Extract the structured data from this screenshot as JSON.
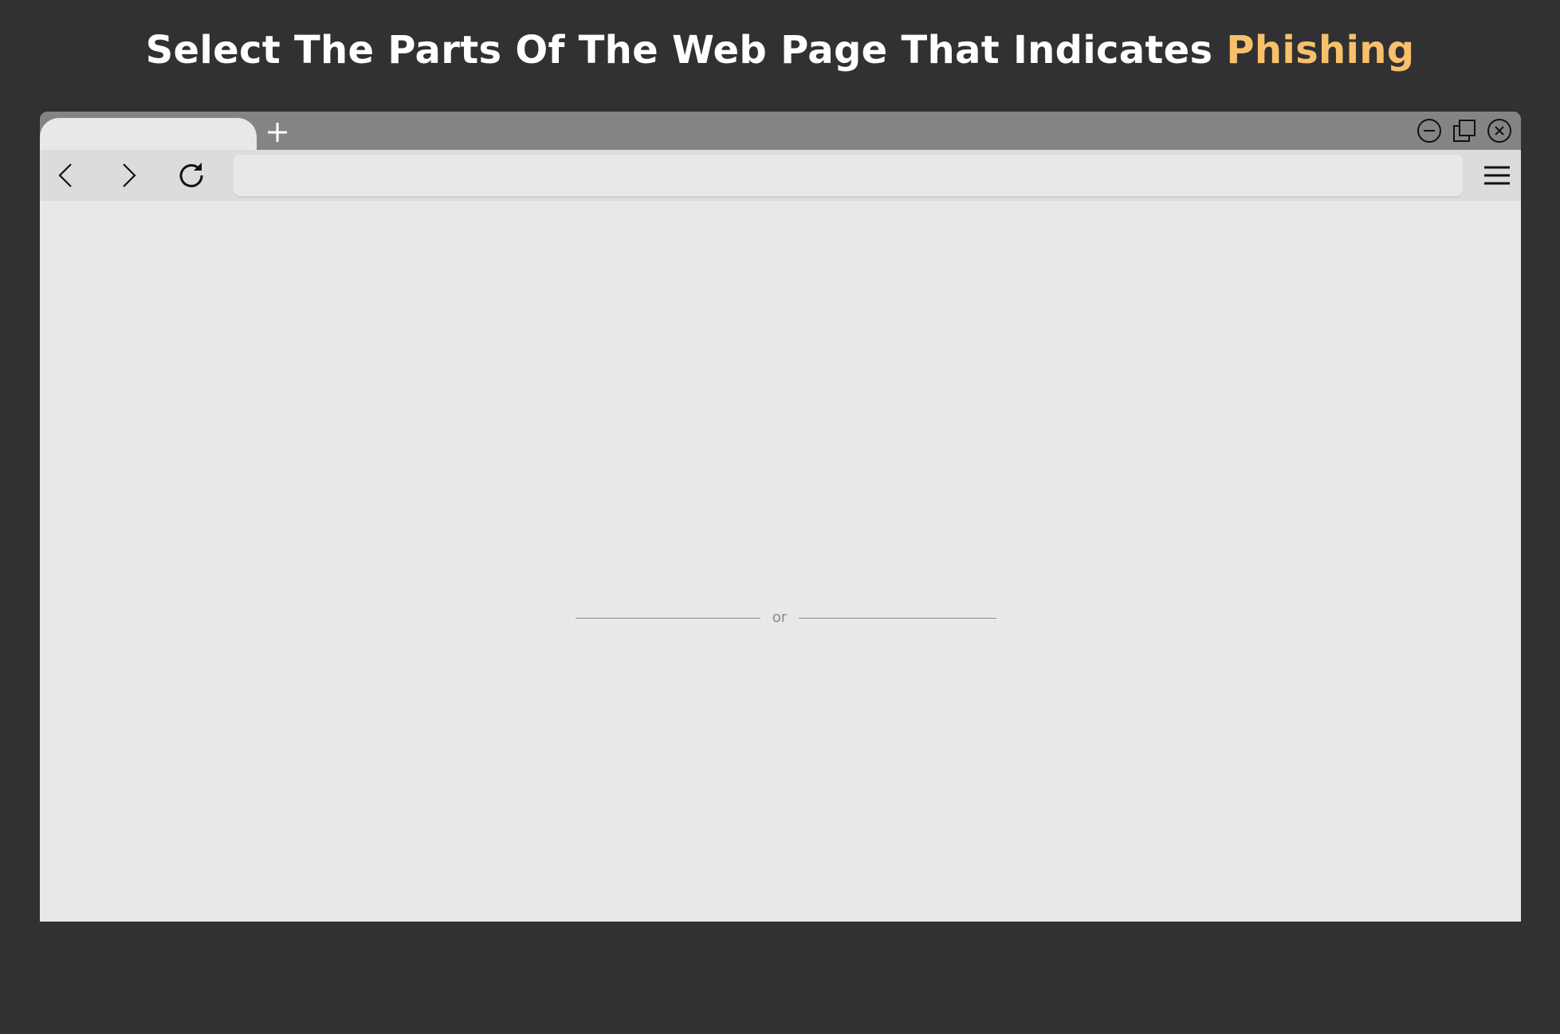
{
  "header": {
    "title_prefix": "Select The Parts Of The Web Page That Indicates",
    "title_accent": "Phishing",
    "accent_color": "#f7c06a"
  },
  "browser": {
    "tab": {
      "label": ""
    },
    "new_tab_icon": "plus-icon",
    "window_controls": [
      "minimize-icon",
      "restore-icon",
      "close-icon"
    ],
    "toolbar": {
      "back_icon": "chevron-left-icon",
      "forward_icon": "chevron-right-icon",
      "reload_icon": "reload-icon",
      "address": {
        "value": "",
        "placeholder": ""
      },
      "menu_icon": "hamburger-menu-icon"
    },
    "content": {
      "divider_text": "or"
    }
  },
  "colors": {
    "background": "#313133",
    "tabbar": "#838486",
    "toolbar": "#dcdcdc",
    "page": "#e8e8e8"
  }
}
